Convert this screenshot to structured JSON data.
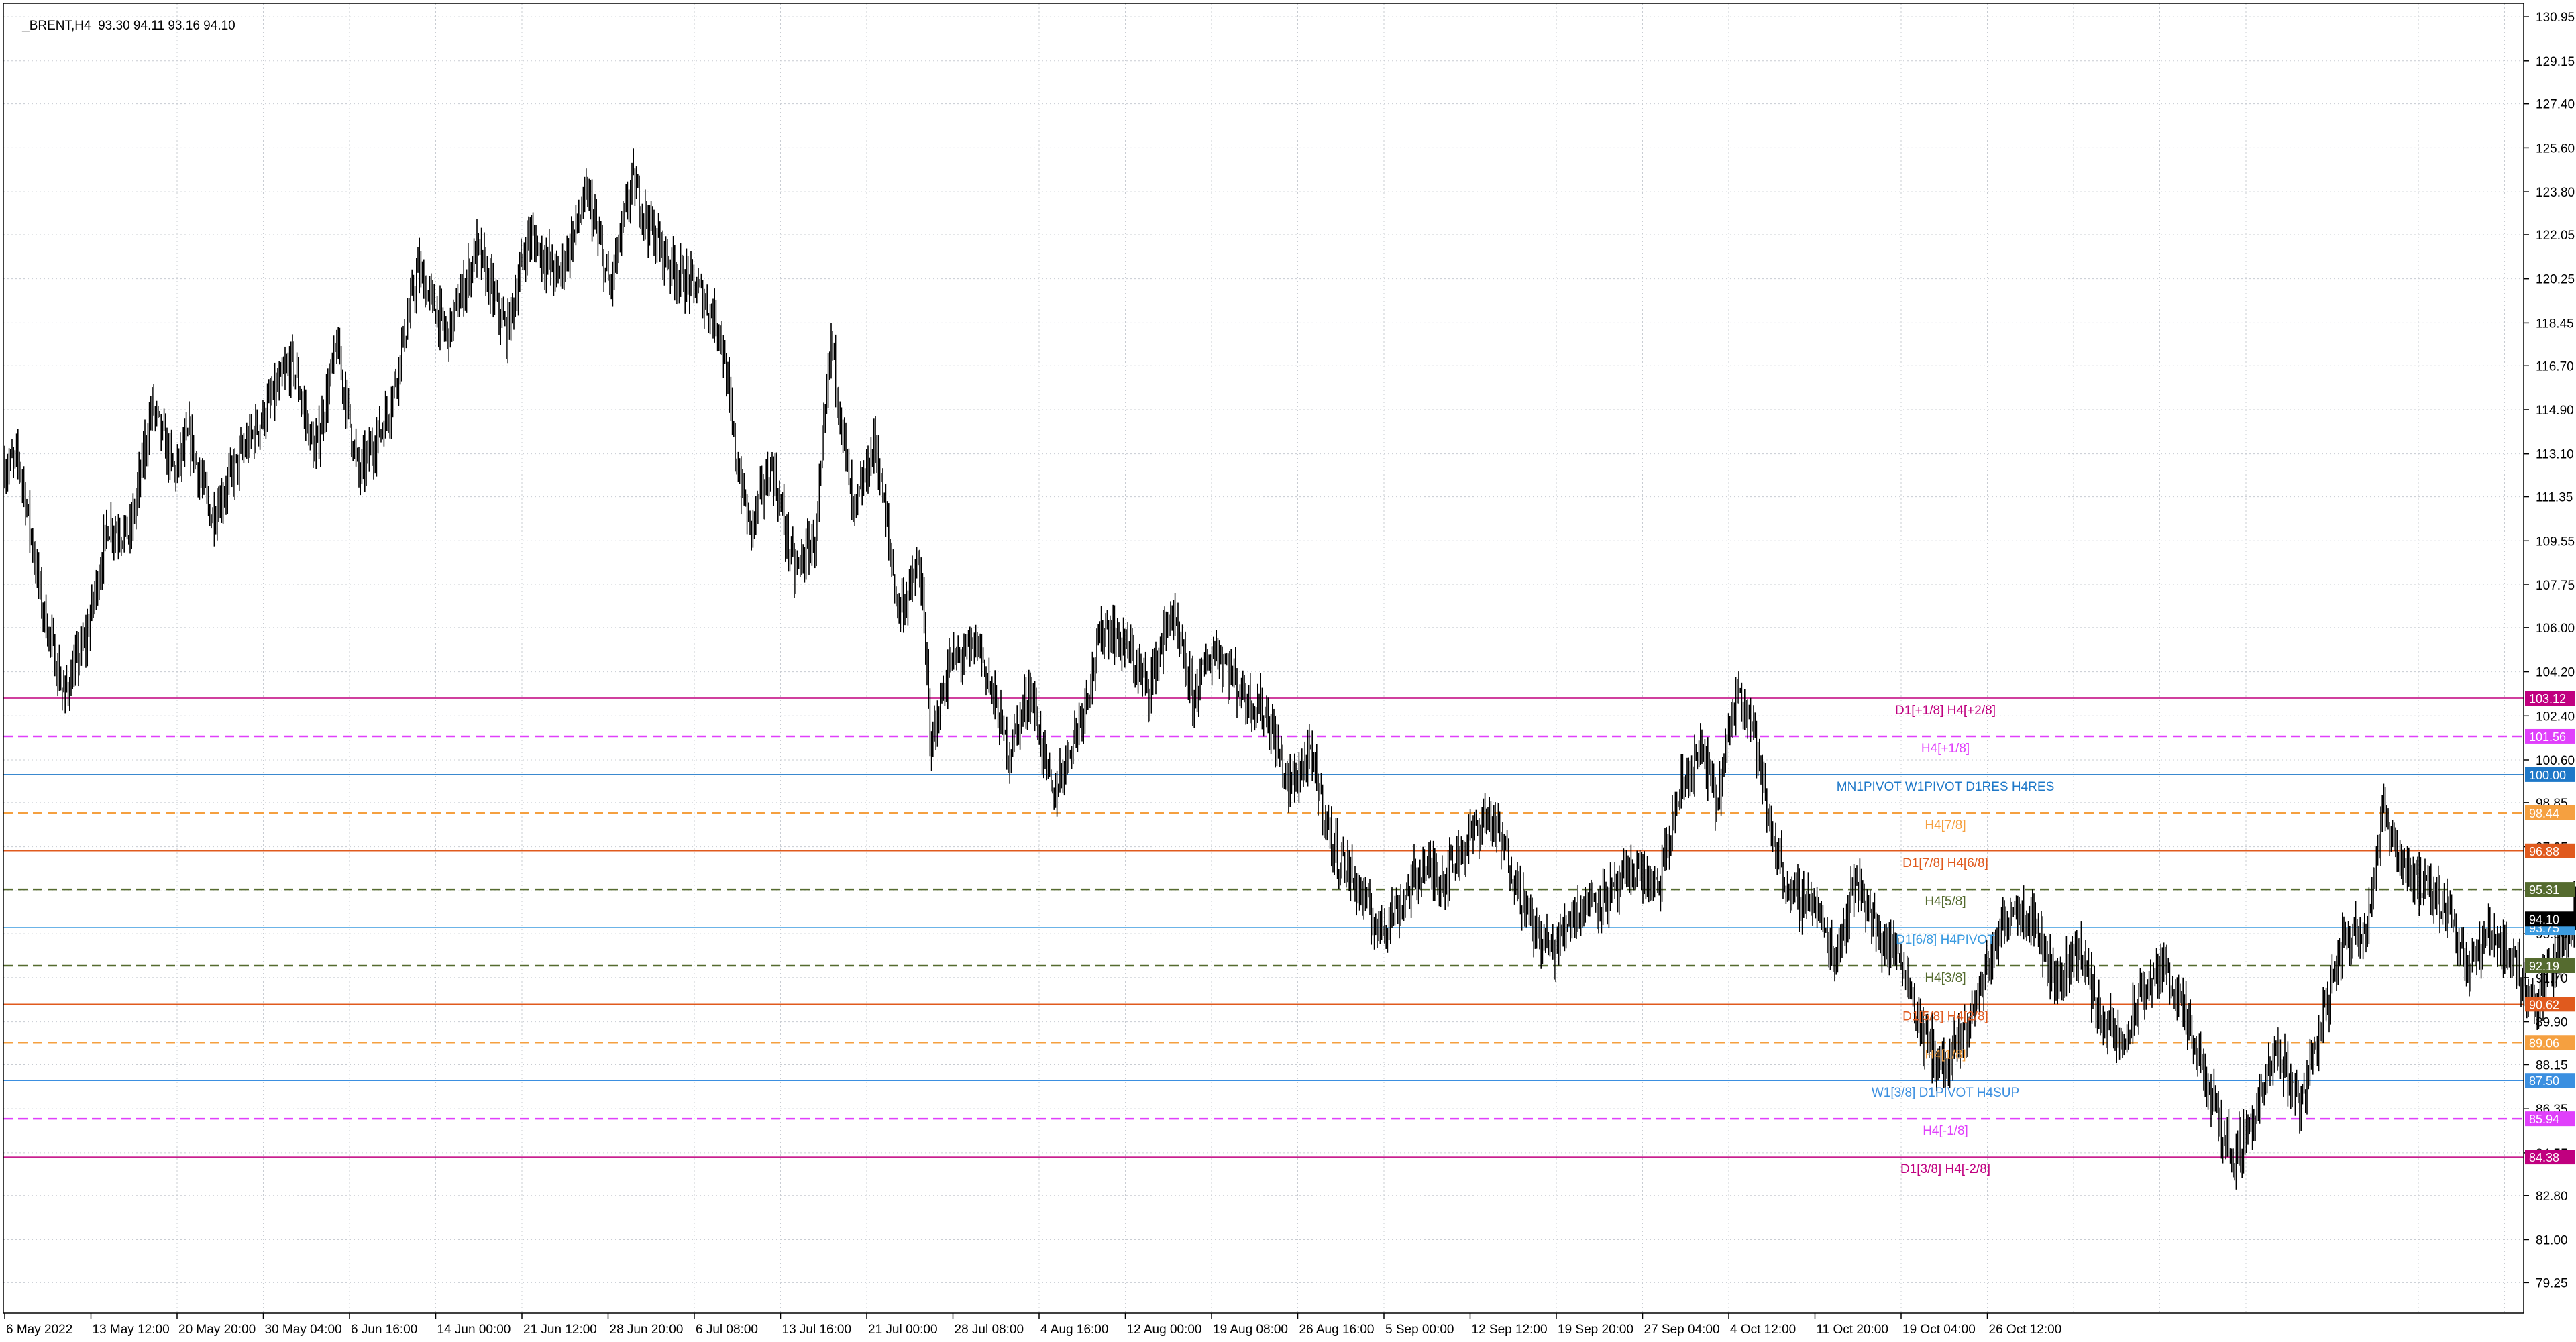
{
  "window": {
    "symbol": "_BRENT,H4",
    "ohlc": "93.30 94.11 93.16 94.10"
  },
  "chart_data": {
    "type": "candlestick",
    "symbol": "_BRENT",
    "timeframe": "H4",
    "grid": true,
    "grid_style": "dotted",
    "ylim": [
      78.0,
      131.5
    ],
    "y_ticks": [
      130.95,
      129.15,
      127.4,
      125.6,
      123.8,
      122.05,
      120.25,
      118.45,
      116.7,
      114.9,
      113.1,
      111.35,
      109.55,
      107.75,
      106.0,
      104.2,
      102.4,
      100.6,
      98.85,
      97.05,
      95.25,
      93.5,
      91.7,
      89.9,
      88.15,
      86.35,
      84.55,
      82.8,
      81.0,
      79.25
    ],
    "x_ticks": [
      "6 May 2022",
      "13 May 12:00",
      "20 May 20:00",
      "30 May 04:00",
      "6 Jun 16:00",
      "14 Jun 00:00",
      "21 Jun 12:00",
      "28 Jun 20:00",
      "6 Jul 08:00",
      "13 Jul 16:00",
      "21 Jul 00:00",
      "28 Jul 08:00",
      "4 Aug 16:00",
      "12 Aug 00:00",
      "19 Aug 08:00",
      "26 Aug 16:00",
      "5 Sep 00:00",
      "12 Sep 12:00",
      "19 Sep 20:00",
      "27 Sep 04:00",
      "4 Oct 12:00",
      "11 Oct 20:00",
      "19 Oct 04:00",
      "26 Oct 12:00"
    ],
    "price_path": [
      [
        0,
        112.6
      ],
      [
        10,
        112.8
      ],
      [
        25,
        107.0
      ],
      [
        40,
        103.2
      ],
      [
        55,
        105.5
      ],
      [
        70,
        110.2
      ],
      [
        85,
        109.8
      ],
      [
        100,
        115.1
      ],
      [
        115,
        112.3
      ],
      [
        125,
        113.8
      ],
      [
        140,
        110.5
      ],
      [
        160,
        113.0
      ],
      [
        175,
        114.6
      ],
      [
        195,
        116.9
      ],
      [
        210,
        113.0
      ],
      [
        225,
        117.5
      ],
      [
        240,
        112.2
      ],
      [
        260,
        114.8
      ],
      [
        280,
        120.6
      ],
      [
        300,
        117.9
      ],
      [
        320,
        121.5
      ],
      [
        340,
        118.0
      ],
      [
        355,
        122.1
      ],
      [
        375,
        120.3
      ],
      [
        395,
        123.7
      ],
      [
        410,
        119.8
      ],
      [
        425,
        124.2
      ],
      [
        440,
        122.0
      ],
      [
        455,
        120.5
      ],
      [
        470,
        119.8
      ],
      [
        485,
        118.2
      ],
      [
        495,
        113.1
      ],
      [
        505,
        110.0
      ],
      [
        520,
        112.6
      ],
      [
        535,
        108.2
      ],
      [
        550,
        109.8
      ],
      [
        560,
        117.8
      ],
      [
        575,
        110.5
      ],
      [
        590,
        113.6
      ],
      [
        605,
        106.8
      ],
      [
        612,
        107.3
      ],
      [
        620,
        108.6
      ],
      [
        628,
        101.2
      ],
      [
        640,
        104.5
      ],
      [
        660,
        105.3
      ],
      [
        680,
        100.9
      ],
      [
        695,
        103.5
      ],
      [
        710,
        99.0
      ],
      [
        730,
        102.6
      ],
      [
        745,
        106.1
      ],
      [
        760,
        105.2
      ],
      [
        775,
        103.5
      ],
      [
        790,
        106.6
      ],
      [
        805,
        103.2
      ],
      [
        820,
        105.2
      ],
      [
        840,
        103.2
      ],
      [
        855,
        102.5
      ],
      [
        870,
        99.5
      ],
      [
        885,
        100.7
      ],
      [
        900,
        97.0
      ],
      [
        915,
        95.6
      ],
      [
        930,
        93.7
      ],
      [
        945,
        94.6
      ],
      [
        960,
        96.2
      ],
      [
        975,
        95.8
      ],
      [
        990,
        97.2
      ],
      [
        1005,
        98.4
      ],
      [
        1020,
        96.4
      ],
      [
        1035,
        93.8
      ],
      [
        1050,
        92.7
      ],
      [
        1060,
        94.2
      ],
      [
        1075,
        94.9
      ],
      [
        1090,
        95.1
      ],
      [
        1105,
        96.2
      ],
      [
        1120,
        95.2
      ],
      [
        1135,
        99.3
      ],
      [
        1150,
        101.0
      ],
      [
        1160,
        98.8
      ],
      [
        1175,
        103.8
      ],
      [
        1185,
        101.9
      ],
      [
        1195,
        98.1
      ],
      [
        1210,
        95.0
      ],
      [
        1225,
        94.9
      ],
      [
        1240,
        92.5
      ],
      [
        1255,
        95.8
      ],
      [
        1270,
        93.3
      ],
      [
        1285,
        92.6
      ],
      [
        1300,
        89.3
      ],
      [
        1315,
        87.9
      ],
      [
        1330,
        89.7
      ],
      [
        1345,
        92.5
      ],
      [
        1360,
        94.7
      ],
      [
        1375,
        94.1
      ],
      [
        1390,
        91.4
      ],
      [
        1405,
        93.0
      ],
      [
        1420,
        90.1
      ],
      [
        1435,
        88.9
      ],
      [
        1450,
        91.3
      ],
      [
        1465,
        92.2
      ],
      [
        1480,
        89.5
      ],
      [
        1495,
        86.8
      ],
      [
        1510,
        84.3
      ],
      [
        1525,
        86.2
      ],
      [
        1540,
        88.8
      ],
      [
        1555,
        86.6
      ],
      [
        1570,
        89.9
      ],
      [
        1585,
        93.3
      ],
      [
        1600,
        93.8
      ],
      [
        1612,
        98.5
      ],
      [
        1625,
        96.4
      ],
      [
        1640,
        95.2
      ],
      [
        1655,
        94.7
      ],
      [
        1670,
        92.1
      ],
      [
        1685,
        93.6
      ],
      [
        1700,
        92.3
      ],
      [
        1715,
        90.7
      ],
      [
        1730,
        92.7
      ],
      [
        1745,
        94.8
      ],
      [
        1760,
        92.9
      ],
      [
        1775,
        94.5
      ],
      [
        1790,
        93.4
      ],
      [
        1805,
        95.5
      ],
      [
        1815,
        96.8
      ],
      [
        1825,
        94.3
      ],
      [
        1832,
        93.3
      ],
      [
        1838,
        94.1
      ]
    ],
    "levels": [
      {
        "label": "D1[+1/8] H4[+2/8]",
        "value": 103.12,
        "price_tag": "103.12",
        "color": "#c0007f",
        "tag_bg": "#c0007f",
        "style": "solid"
      },
      {
        "label": "H4[+1/8]",
        "value": 101.56,
        "price_tag": "101.56",
        "color": "#e040fb",
        "tag_bg": "#e040fb",
        "style": "dashed"
      },
      {
        "label": "MN1PIVOT W1PIVOT D1RES H4RES",
        "value": 100.0,
        "price_tag": "100.00",
        "color": "#1e78c8",
        "tag_bg": "#1e78c8",
        "style": "solid"
      },
      {
        "label": "H4[7/8]",
        "value": 98.44,
        "price_tag": "98.44",
        "color": "#f5a040",
        "tag_bg": "#f5a040",
        "style": "dashed"
      },
      {
        "label": "D1[7/8] H4[6/8]",
        "value": 96.88,
        "price_tag": "96.88",
        "color": "#e05a1e",
        "tag_bg": "#e05a1e",
        "style": "solid"
      },
      {
        "label": "H4[5/8]",
        "value": 95.31,
        "price_tag": "95.31",
        "color": "#556b2f",
        "tag_bg": "#556b2f",
        "style": "dashed"
      },
      {
        "label": "D1[6/8] H4PIVOT",
        "value": 93.75,
        "price_tag": "93.75",
        "color": "#3b9be0",
        "tag_bg": "#3b9be0",
        "style": "solid"
      },
      {
        "label": "H4[3/8]",
        "value": 92.19,
        "price_tag": "92.19",
        "color": "#556b2f",
        "tag_bg": "#556b2f",
        "style": "dashed"
      },
      {
        "label": "D1[5/8] H4[2/8]",
        "value": 90.62,
        "price_tag": "90.62",
        "color": "#e05a1e",
        "tag_bg": "#e05a1e",
        "style": "solid"
      },
      {
        "label": "H4[1/8]",
        "value": 89.06,
        "price_tag": "89.06",
        "color": "#f5a040",
        "tag_bg": "#f5a040",
        "style": "dashed"
      },
      {
        "label": "W1[3/8] D1PIVOT H4SUP",
        "value": 87.5,
        "price_tag": "87.50",
        "color": "#3b8fe0",
        "tag_bg": "#3b8fe0",
        "style": "solid"
      },
      {
        "label": "H4[-1/8]",
        "value": 85.94,
        "price_tag": "85.94",
        "color": "#e040fb",
        "tag_bg": "#e040fb",
        "style": "dashed"
      },
      {
        "label": "D1[3/8] H4[-2/8]",
        "value": 84.38,
        "price_tag": "84.38",
        "color": "#c0007f",
        "tag_bg": "#c0007f",
        "style": "solid"
      }
    ],
    "current_price": {
      "value": 94.1,
      "price_tag": "94.10",
      "tag_bg": "#000000"
    }
  },
  "colors": {
    "background": "#ffffff",
    "grid": "#c8ccd2",
    "axis_text": "#000000",
    "candles": "#000000"
  }
}
